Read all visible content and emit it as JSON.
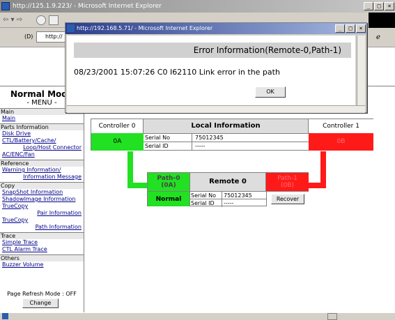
{
  "browser": {
    "title": "http://125.1.9.223/ - Microsoft Internet Explorer",
    "address": "http://",
    "status": ""
  },
  "dialog": {
    "title": "http://192.168.5.71/ - Microsoft Internet Explorer",
    "header": "Error Information(Remote-0,Path-1)",
    "message": "08/23/2001 15:07:26 C0 I62110 Link error in the path",
    "ok": "OK"
  },
  "menu": {
    "title": "Normal Mode",
    "subtitle": "- MENU -",
    "sections": [
      {
        "label": "Main",
        "links": [
          {
            "text": "Main",
            "align": "l"
          }
        ]
      },
      {
        "label": "Parts Information",
        "links": [
          {
            "text": "Disk Drive",
            "align": "l"
          },
          {
            "text": "CTL/Battery/Cache/",
            "align": "l"
          },
          {
            "text": "Loop/Host Connector",
            "align": "r"
          },
          {
            "text": "AC/ENC/Fan",
            "align": "l"
          }
        ]
      },
      {
        "label": "Reference",
        "links": [
          {
            "text": "Warning Information/",
            "align": "l"
          },
          {
            "text": "Information Message",
            "align": "r"
          }
        ]
      },
      {
        "label": "Copy",
        "links": [
          {
            "text": "SnapShot Information",
            "align": "l"
          },
          {
            "text": "ShadowImage Information",
            "align": "l"
          },
          {
            "text": "TrueCopy",
            "align": "l"
          },
          {
            "text": "Pair Information",
            "align": "r"
          },
          {
            "text": "TrueCopy",
            "align": "l"
          },
          {
            "text": "Path Information",
            "align": "r"
          }
        ]
      },
      {
        "label": "Trace",
        "links": [
          {
            "text": "Simple Trace",
            "align": "l"
          },
          {
            "text": "CTL Alarm Trace",
            "align": "l"
          }
        ]
      },
      {
        "label": "Others",
        "links": [
          {
            "text": "Buzzer Volume",
            "align": "l"
          }
        ]
      }
    ],
    "refresh_mode": "Page Refresh Mode : OFF",
    "change": "Change"
  },
  "local": {
    "controller0": "Controller 0",
    "heading": "Local Information",
    "controller1": "Controller 1",
    "port0": "0A",
    "port1": "0B",
    "serial_no_label": "Serial No",
    "serial_no": "75012345",
    "serial_id_label": "Serial ID",
    "serial_id": "-----"
  },
  "remote": {
    "path0": "Path-0\n(0A)",
    "heading": "Remote 0",
    "path1": "Path-1\n(0B)",
    "status": "Normal",
    "serial_no_label": "Serial No",
    "serial_no": "75012345",
    "serial_id_label": "Serial ID",
    "serial_id": "-----",
    "recover": "Recover"
  }
}
